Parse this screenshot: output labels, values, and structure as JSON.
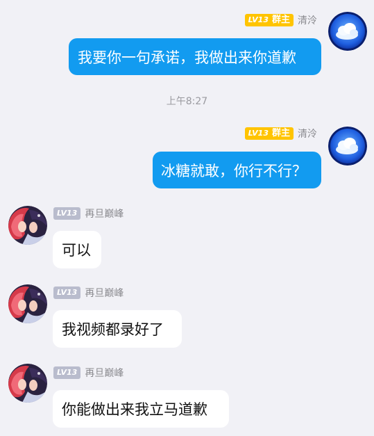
{
  "timestamp": "上午8:27",
  "messages": [
    {
      "side": "out",
      "level": "LV13",
      "role": "群主",
      "name": "清泠",
      "text": "我要你一句承诺，我做出来你道歉"
    },
    {
      "side": "out",
      "level": "LV13",
      "role": "群主",
      "name": "清泠",
      "text": "冰糖就敢，你行不行？"
    },
    {
      "side": "in",
      "level": "LV13",
      "name": "再旦巅峰",
      "text": "可以"
    },
    {
      "side": "in",
      "level": "LV13",
      "name": "再旦巅峰",
      "text": "我视频都录好了"
    },
    {
      "side": "in",
      "level": "LV13",
      "name": "再旦巅峰",
      "text": "你能做出来我立马道歉"
    }
  ],
  "colors": {
    "background": "#f1f1f6",
    "outgoing_bubble": "#129bf0",
    "incoming_bubble": "#ffffff",
    "owner_badge": "#ffc400",
    "level_badge": "#b9bccd"
  }
}
